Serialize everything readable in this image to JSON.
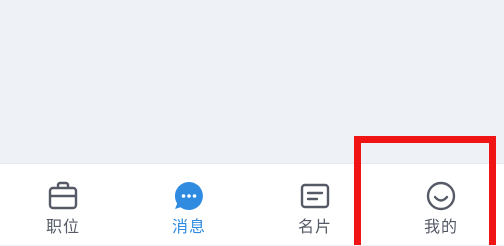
{
  "tabs": [
    {
      "label": "职位",
      "icon": "briefcase-icon",
      "active": false
    },
    {
      "label": "消息",
      "icon": "chat-bubble-icon",
      "active": true
    },
    {
      "label": "名片",
      "icon": "card-icon",
      "active": false
    },
    {
      "label": "我的",
      "icon": "smiley-face-icon",
      "active": false
    }
  ],
  "colors": {
    "active": "#2e8be0",
    "inactive": "#555a66",
    "highlight": "#f01414"
  }
}
